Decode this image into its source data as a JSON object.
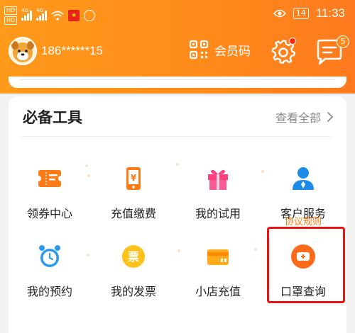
{
  "status_bar": {
    "hd_1": "HD",
    "hd_2": "HD",
    "net_1": "4G",
    "net_2": "4G",
    "battery": "14",
    "time": "11:33"
  },
  "header": {
    "phone": "186******15",
    "member_code_label": "会员码",
    "message_badge": "5"
  },
  "tools_section": {
    "title": "必备工具",
    "view_all": "查看全部",
    "items": [
      {
        "label": "领券中心",
        "icon": "coupon-icon"
      },
      {
        "label": "充值缴费",
        "icon": "phone-recharge-icon"
      },
      {
        "label": "我的试用",
        "icon": "gift-icon"
      },
      {
        "label": "客户服务",
        "icon": "customer-service-icon"
      },
      {
        "label": "我的预约",
        "icon": "alarm-clock-icon"
      },
      {
        "label": "我的发票",
        "icon": "invoice-icon"
      },
      {
        "label": "小店充值",
        "icon": "card-icon"
      },
      {
        "label": "口罩查询",
        "icon": "mask-icon"
      }
    ],
    "protocol_link": "协议规则",
    "invoice_glyph": "票"
  },
  "colors": {
    "header_orange": "#ff8a1a",
    "accent_orange": "#ff7b16",
    "highlight_red": "#e81414"
  }
}
